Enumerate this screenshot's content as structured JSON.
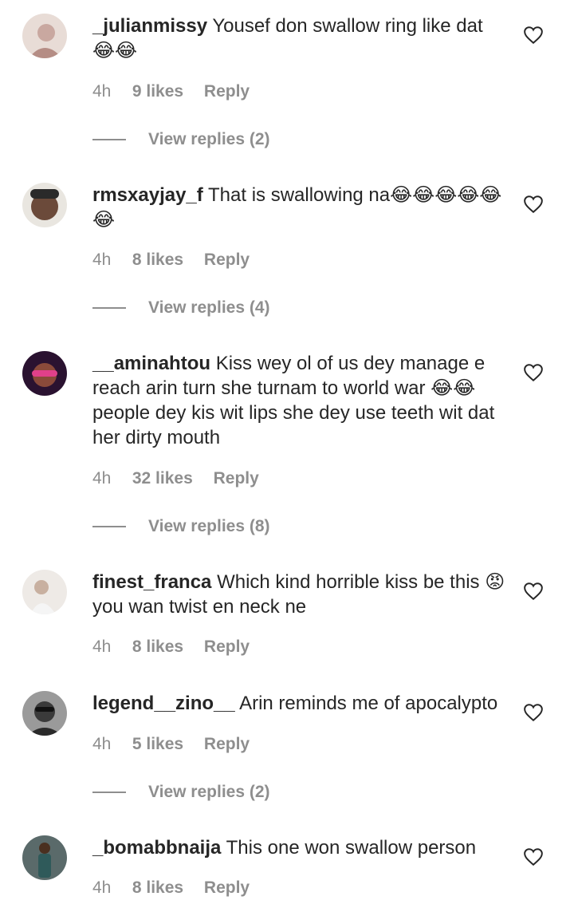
{
  "comments": [
    {
      "username": "_julianmissy",
      "text": "Yousef don swallow ring like dat 😂😂",
      "time": "4h",
      "likes": "9 likes",
      "reply": "Reply",
      "view_replies": "View replies (2)",
      "avatar_color": "#c9a8a0"
    },
    {
      "username": "rmsxayjay_f",
      "text": "That is swallowing na😂😂😂😂😂😂",
      "time": "4h",
      "likes": "8 likes",
      "reply": "Reply",
      "view_replies": "View replies (4)",
      "avatar_color": "#6b4a3a"
    },
    {
      "username": "__aminahtou",
      "text": "Kiss wey ol of us dey manage e reach arin turn she turnam to world war 😂😂 people dey kis wit lips she dey use teeth wit dat her dirty mouth",
      "time": "4h",
      "likes": "32 likes",
      "reply": "Reply",
      "view_replies": "View replies (8)",
      "avatar_color": "#3a1a3a"
    },
    {
      "username": "finest_franca",
      "text": "Which kind horrible kiss be this 😡 you wan twist en neck ne",
      "time": "4h",
      "likes": "8 likes",
      "reply": "Reply",
      "view_replies": "",
      "avatar_color": "#d8d2cc"
    },
    {
      "username": "legend__zino__",
      "text": "Arin reminds me of apocalypto",
      "time": "4h",
      "likes": "5 likes",
      "reply": "Reply",
      "view_replies": "View replies (2)",
      "avatar_color": "#5a5a5a"
    },
    {
      "username": "_bomabbnaija",
      "text": "This one won swallow person",
      "time": "4h",
      "likes": "8 likes",
      "reply": "Reply",
      "view_replies": "",
      "avatar_color": "#3d4a4a"
    }
  ]
}
